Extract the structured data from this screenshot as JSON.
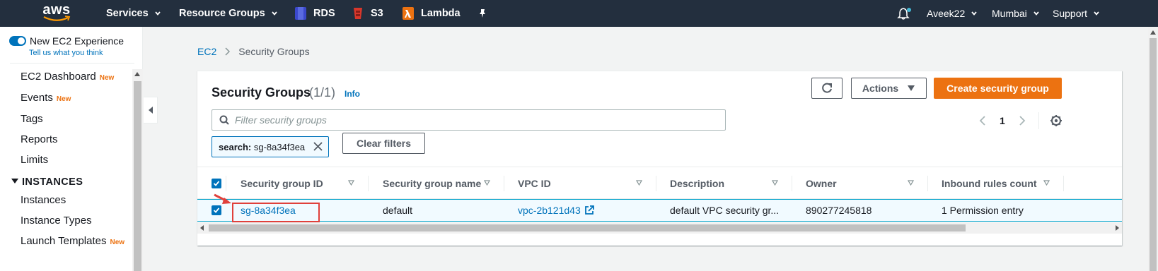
{
  "topnav": {
    "logo": "aws",
    "services": "Services",
    "resource_groups": "Resource Groups",
    "rds": "RDS",
    "s3": "S3",
    "lambda": "Lambda",
    "user": "Aveek22",
    "region": "Mumbai",
    "support": "Support",
    "colors": {
      "bg": "#232f3e",
      "rds": "#3b48cc",
      "s3": "#d9372b",
      "lambda": "#ec7211",
      "notification_dot": "#44b9d6"
    }
  },
  "sidebar": {
    "toggle_label": "New EC2 Experience",
    "tell_us": "Tell us what you think",
    "items": [
      {
        "label": "EC2 Dashboard",
        "badge": "New"
      },
      {
        "label": "Events",
        "badge": "New"
      },
      {
        "label": "Tags",
        "badge": ""
      },
      {
        "label": "Reports",
        "badge": ""
      },
      {
        "label": "Limits",
        "badge": ""
      }
    ],
    "section": "INSTANCES",
    "section_items": [
      {
        "label": "Instances",
        "badge": ""
      },
      {
        "label": "Instance Types",
        "badge": ""
      },
      {
        "label": "Launch Templates",
        "badge": "New"
      }
    ]
  },
  "breadcrumb": {
    "root": "EC2",
    "current": "Security Groups"
  },
  "panel": {
    "title": "Security Groups",
    "count": "(1/1)",
    "info": "Info",
    "actions": "Actions",
    "create": "Create security group",
    "filter_placeholder": "Filter security groups",
    "page": "1",
    "token_key": "search:",
    "token_value": "sg-8a34f3ea",
    "clear_filters": "Clear filters",
    "accent": "#ec7211"
  },
  "table": {
    "columns": [
      "Security group ID",
      "Security group name",
      "VPC ID",
      "Description",
      "Owner",
      "Inbound rules count"
    ],
    "rows": [
      {
        "selected": true,
        "id": "sg-8a34f3ea",
        "name": "default",
        "vpc": "vpc-2b121d43",
        "description": "default VPC security gr...",
        "owner": "890277245818",
        "inbound": "1 Permission entry"
      }
    ]
  }
}
